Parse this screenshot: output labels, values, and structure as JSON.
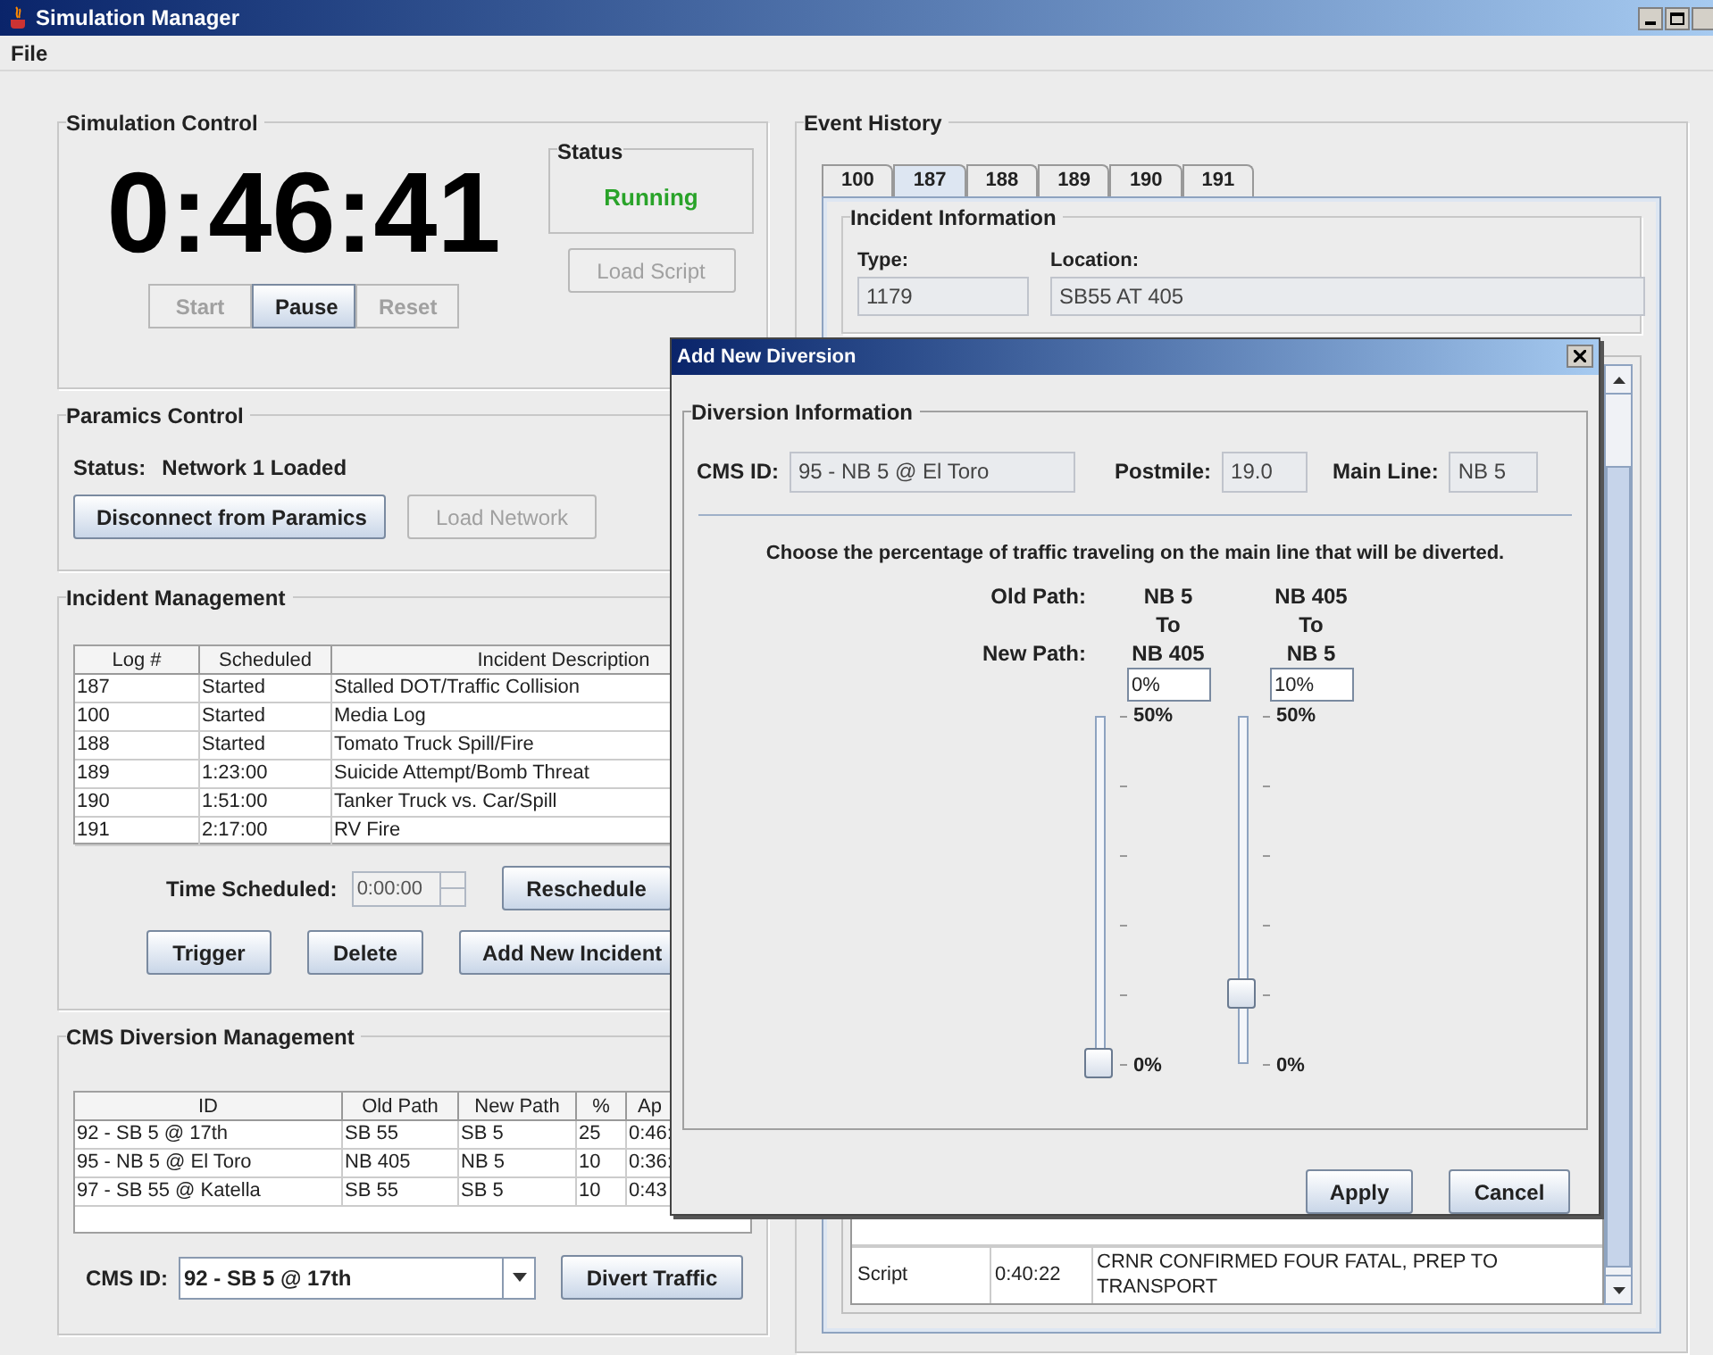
{
  "window": {
    "title": "Simulation Manager"
  },
  "menu": [
    "File"
  ],
  "simulation_control": {
    "title": "Simulation Control",
    "clock": "0:46:41",
    "status_label": "Status",
    "status": "Running",
    "buttons": [
      {
        "label": "Start",
        "disabled": true
      },
      {
        "label": "Pause",
        "disabled": false
      },
      {
        "label": "Reset",
        "disabled": true
      }
    ],
    "load_script": {
      "label": "Load Script",
      "disabled": true
    }
  },
  "paramics": {
    "title": "Paramics Control",
    "status_label": "Status:",
    "status": "Network 1 Loaded",
    "buttons": [
      {
        "label": "Disconnect from Paramics",
        "disabled": false
      },
      {
        "label": "Load Network",
        "disabled": true
      }
    ]
  },
  "incident_management": {
    "title": "Incident Management",
    "columns": [
      "Log #",
      "Scheduled",
      "Incident Description"
    ],
    "rows": [
      [
        "187",
        "Started",
        "Stalled DOT/Traffic Collision"
      ],
      [
        "100",
        "Started",
        "Media Log"
      ],
      [
        "188",
        "Started",
        "Tomato Truck Spill/Fire"
      ],
      [
        "189",
        "1:23:00",
        "Suicide Attempt/Bomb Threat"
      ],
      [
        "190",
        "1:51:00",
        "Tanker Truck vs. Car/Spill"
      ],
      [
        "191",
        "2:17:00",
        "RV Fire"
      ]
    ],
    "time_label": "Time Scheduled:",
    "time_value": "0:00:00",
    "reschedule": "Reschedule",
    "buttons": [
      "Trigger",
      "Delete",
      "Add New Incident"
    ]
  },
  "cms_diversion": {
    "title": "CMS Diversion Management",
    "columns": [
      "ID",
      "Old Path",
      "New Path",
      "%",
      "Ap"
    ],
    "rows": [
      [
        "92 - SB 5 @ 17th",
        "SB 55",
        "SB 5",
        "25",
        "0:46:"
      ],
      [
        "95 - NB 5 @ El Toro",
        "NB 405",
        "NB 5",
        "10",
        "0:36:"
      ],
      [
        "97 - SB 55 @ Katella",
        "SB 55",
        "SB 5",
        "10",
        "0:43"
      ]
    ],
    "cms_id_label": "CMS ID:",
    "cms_id": "92 - SB 5 @ 17th",
    "button": "Divert Traffic"
  },
  "event_history": {
    "title": "Event History",
    "tabs": [
      {
        "label": "100",
        "selected": false
      },
      {
        "label": "187",
        "selected": true
      },
      {
        "label": "188",
        "selected": false
      },
      {
        "label": "189",
        "selected": false
      },
      {
        "label": "190",
        "selected": false
      },
      {
        "label": "191",
        "selected": false
      }
    ],
    "incident_info": {
      "title": "Incident Information",
      "type_label": "Type:",
      "type": "1179",
      "location_label": "Location:",
      "location": "SB55 AT 405"
    },
    "events": [
      {
        "source": "Script",
        "time": "0:40:22",
        "text": "CRNR CONFIRMED FOUR FATAL, PREP TO TRANSPORT"
      }
    ]
  },
  "dialog": {
    "title": "Add New Diversion",
    "section": "Diversion Information",
    "cms_id_label": "CMS ID:",
    "cms_id": "95 - NB 5 @ El Toro",
    "postmile_label": "Postmile:",
    "postmile": "19.0",
    "main_line_label": "Main Line:",
    "main_line": "NB 5",
    "instruction": "Choose the percentage of traffic traveling on the main line that will be diverted.",
    "old_path_label": "Old Path:",
    "new_path_label": "New Path:",
    "sliders": [
      {
        "old_path": "NB 5",
        "to": "To",
        "new_path": "NB 405",
        "value": "0%",
        "level": 0,
        "max_label": "50%",
        "min_label": "0%"
      },
      {
        "old_path": "NB 405",
        "to": "To",
        "new_path": "NB 5",
        "value": "10%",
        "level": 0.2,
        "max_label": "50%",
        "min_label": "0%"
      }
    ],
    "buttons": [
      "Apply",
      "Cancel"
    ]
  }
}
